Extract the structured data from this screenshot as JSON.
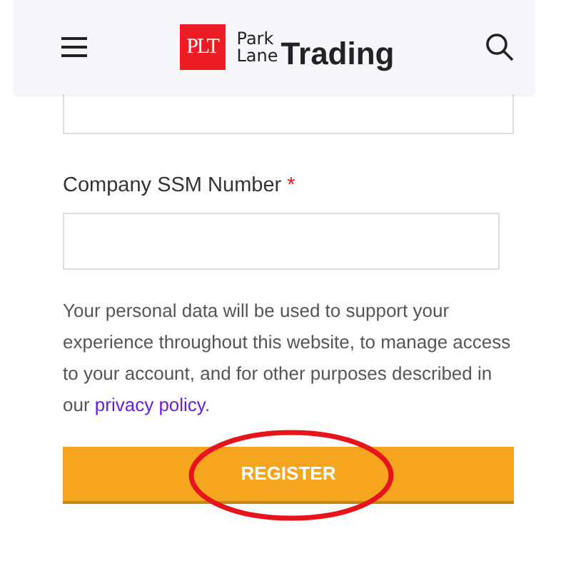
{
  "header": {
    "logo": {
      "mark": "PLT",
      "line1": "Park",
      "line2": "Lane",
      "word": "Trading"
    }
  },
  "fields": [
    {
      "label": "Company SSM Number",
      "required_mark": "*"
    }
  ],
  "privacy_notice": {
    "text": "Your personal data will be used to support your experience throughout this website, to manage access to your account, and for other purposes described in our ",
    "link": "privacy policy",
    "after": "."
  },
  "register_button": {
    "label": "REGISTER",
    "circled": true
  }
}
